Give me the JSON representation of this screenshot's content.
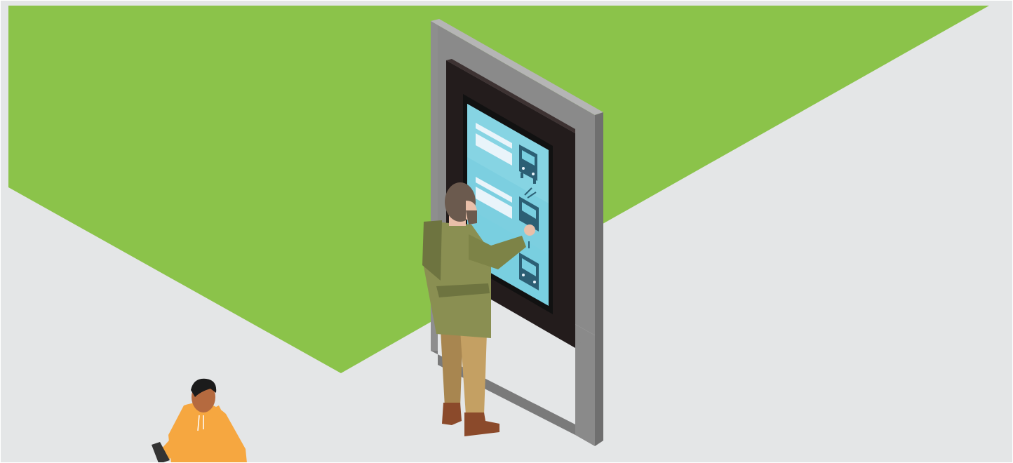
{
  "scene": {
    "colors": {
      "lawn": "#8bc34a",
      "pavement": "#e4e6e7",
      "kiosk_frame": "#8a8a8a",
      "kiosk_frame_light": "#a9a9a9",
      "kiosk_frame_dark": "#6f6f6f",
      "kiosk_bezel": "#231c1c",
      "screen": "#79cfe0",
      "screen_stripe": "#9ddbe8",
      "screen_bar": "#e9f4fa",
      "vehicle_icon": "#2c5f74",
      "man_jacket": "#8a8f52",
      "man_jacket_shadow": "#6e7440",
      "man_pants": "#c4a063",
      "man_pants_shadow": "#a88650",
      "man_boots": "#8b4a2b",
      "man_hair": "#6b5a4e",
      "man_skin": "#e9bfa9",
      "woman_hoodie": "#f6a740",
      "woman_skin": "#b56a3f",
      "woman_hair": "#1b1b1b",
      "phone": "#333333"
    },
    "screen_icons": [
      "bus-icon",
      "trolleybus-icon",
      "tram-icon"
    ]
  }
}
